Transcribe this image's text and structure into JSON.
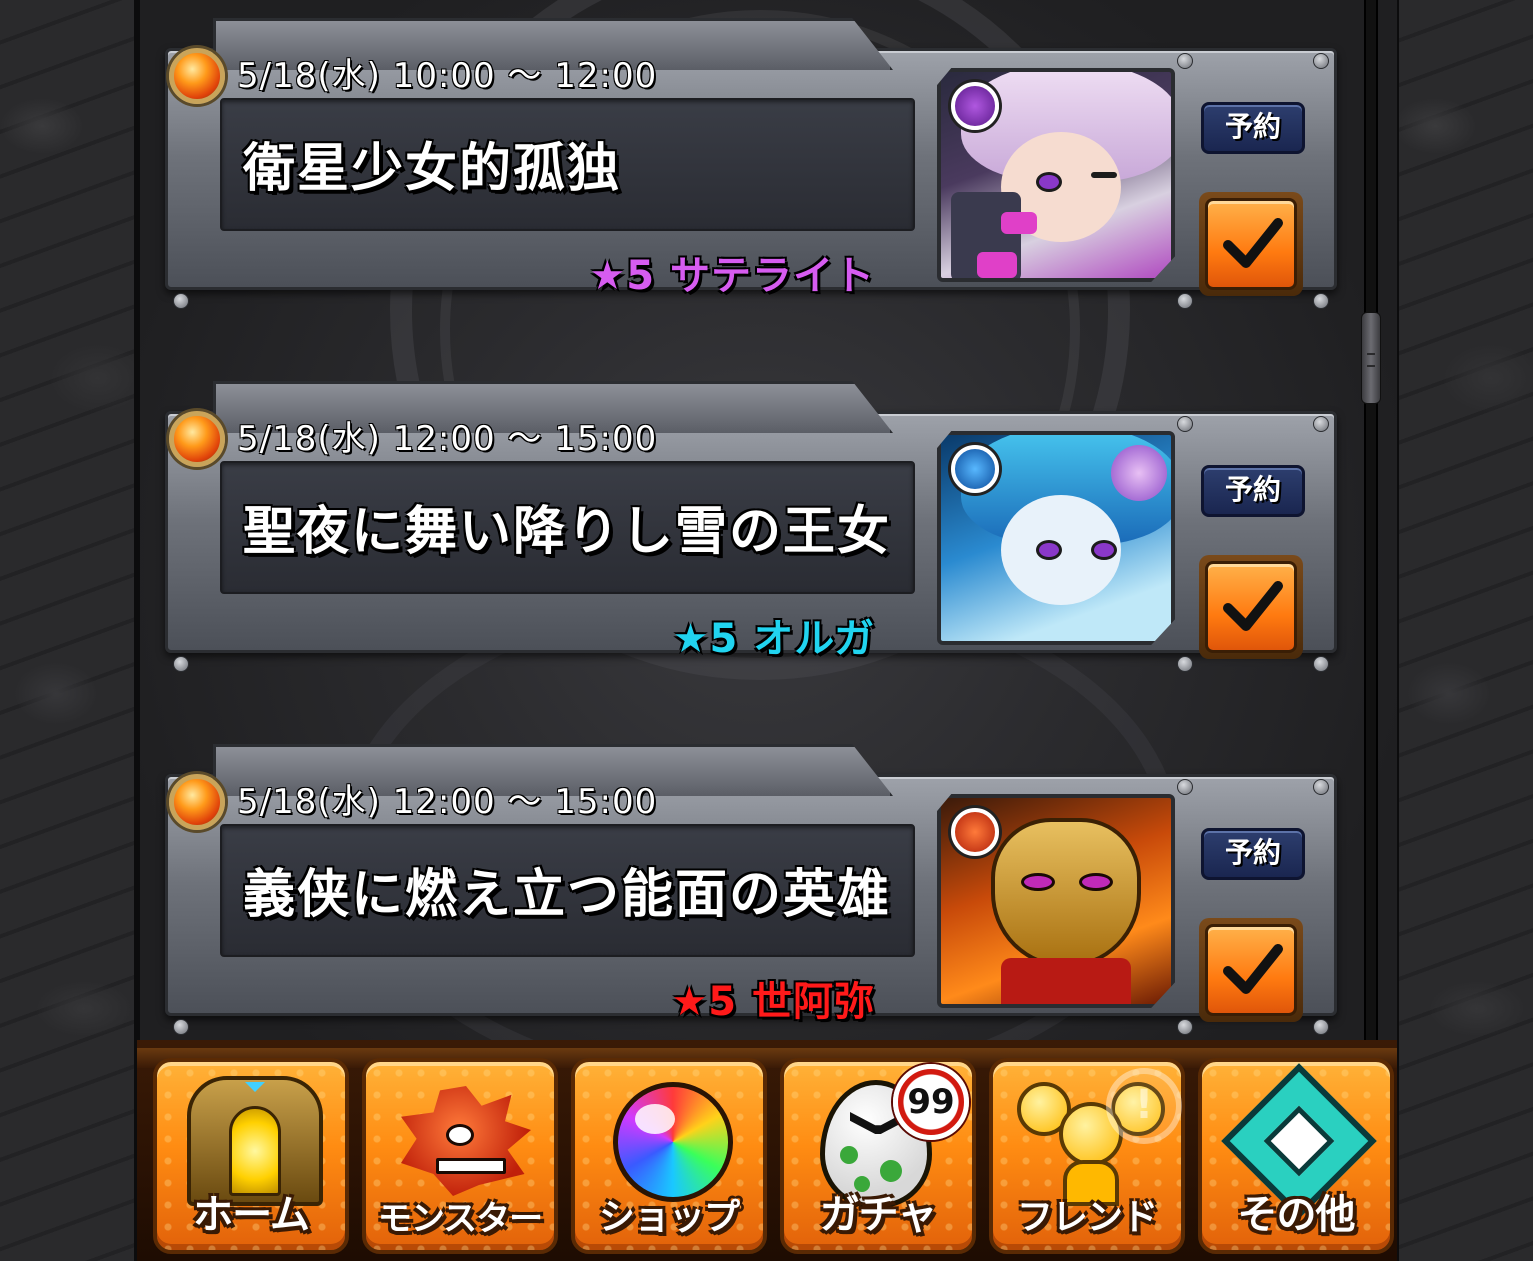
{
  "events": [
    {
      "date": "5/18(水) 10:00 ～ 12:00",
      "title": "衛星少女的孤独",
      "monster": "★5 サテライト",
      "monster_color": "#d65cf0",
      "reserve_label": "予約",
      "reserved": true,
      "portrait_icon": "satellite-monster-portrait-icon",
      "element_icon": "dark-element-icon"
    },
    {
      "date": "5/18(水) 12:00 ～ 15:00",
      "title": "聖夜に舞い降りし雪の王女",
      "monster": "★5 オルガ",
      "monster_color": "#21d4f0",
      "reserve_label": "予約",
      "reserved": true,
      "portrait_icon": "olga-monster-portrait-icon",
      "element_icon": "water-element-icon"
    },
    {
      "date": "5/18(水) 12:00 ～ 15:00",
      "title": "義侠に燃え立つ能面の英雄",
      "monster": "★5 世阿弥",
      "monster_color": "#ff1a1a",
      "reserve_label": "予約",
      "reserved": true,
      "portrait_icon": "zeami-monster-portrait-icon",
      "element_icon": "fire-element-icon"
    }
  ],
  "nav": {
    "items": [
      {
        "label": "ホーム",
        "icon": "home-gate-icon"
      },
      {
        "label": "モンスター",
        "icon": "monster-dragon-icon"
      },
      {
        "label": "ショップ",
        "icon": "rainbow-orb-icon"
      },
      {
        "label": "ガチャ",
        "icon": "gacha-egg-icon"
      },
      {
        "label": "フレンド",
        "icon": "friends-icon"
      },
      {
        "label": "その他",
        "icon": "other-menu-icon"
      }
    ],
    "gacha_badge": "99",
    "friend_badge": "!"
  },
  "colors": {
    "accent_orange": "#ff8c12",
    "reserve_blue": "#2d3e6e",
    "panel_gray": "#6e727a"
  }
}
